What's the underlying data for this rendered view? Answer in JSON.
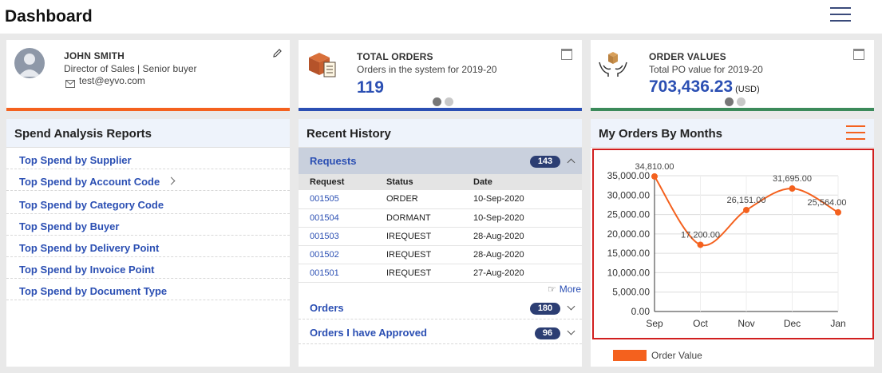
{
  "header": {
    "title": "Dashboard"
  },
  "profile": {
    "name": "JOHN SMITH",
    "role": "Director of Sales | Senior buyer",
    "email": "test@eyvo.com"
  },
  "total_orders": {
    "heading": "TOTAL ORDERS",
    "subtitle": "Orders in the system for 2019-20",
    "value": "119"
  },
  "order_values": {
    "heading": "ORDER VALUES",
    "subtitle": "Total PO value for 2019-20",
    "value": "703,436.23",
    "unit": "(USD)"
  },
  "spend": {
    "title": "Spend Analysis Reports",
    "items": [
      "Top Spend by Supplier",
      "Top Spend by Account Code",
      "Top Spend by Category Code",
      "Top Spend by Buyer",
      "Top Spend by Delivery Point",
      "Top Spend by Invoice Point",
      "Top Spend by Document Type"
    ]
  },
  "history": {
    "title": "Recent History",
    "requests": {
      "label": "Requests",
      "count": "143"
    },
    "columns": [
      "Request",
      "Status",
      "Date"
    ],
    "rows": [
      [
        "001505",
        "ORDER",
        "10-Sep-2020"
      ],
      [
        "001504",
        "DORMANT",
        "10-Sep-2020"
      ],
      [
        "001503",
        "IREQUEST",
        "28-Aug-2020"
      ],
      [
        "001502",
        "IREQUEST",
        "28-Aug-2020"
      ],
      [
        "001501",
        "IREQUEST",
        "27-Aug-2020"
      ]
    ],
    "more": "More",
    "orders": {
      "label": "Orders",
      "count": "180"
    },
    "approved": {
      "label": "Orders I have Approved",
      "count": "96"
    }
  },
  "orders_chart": {
    "title": "My Orders By Months"
  },
  "colors": {
    "accent_orange": "#f4611e",
    "accent_blue": "#2b4fb3",
    "bar_green": "#3b8a5a",
    "badge": "#2c3e73"
  },
  "chart_data": {
    "type": "line",
    "categories": [
      "Sep",
      "Oct",
      "Nov",
      "Dec",
      "Jan"
    ],
    "series": [
      {
        "name": "Order Value",
        "values": [
          34810,
          17200,
          26151,
          31695,
          25564
        ]
      }
    ],
    "data_labels": [
      "34,810.00",
      "17,200.00",
      "26,151.00",
      "31,695.00",
      "25,564.00"
    ],
    "y_ticks": [
      "0.00",
      "5,000.00",
      "10,000.00",
      "15,000.00",
      "20,000.00",
      "25,000.00",
      "30,000.00",
      "35,000.00"
    ],
    "ylim": [
      0,
      35000
    ],
    "grid": true,
    "legend": "bottom-left"
  }
}
